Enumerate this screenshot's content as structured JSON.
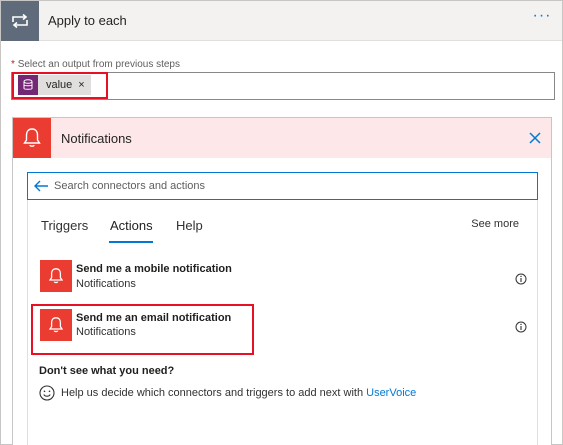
{
  "apply_each": {
    "title": "Apply to each",
    "menu_label": "···",
    "select_label": "Select an output from previous steps",
    "required_mark": "*",
    "token": {
      "label": "value",
      "remove": "×"
    }
  },
  "notifications": {
    "title": "Notifications",
    "search": {
      "placeholder": "Search connectors and actions"
    },
    "tabs": [
      {
        "label": "Triggers",
        "selected": false
      },
      {
        "label": "Actions",
        "selected": true
      },
      {
        "label": "Help",
        "selected": false
      }
    ],
    "see_more": "See more",
    "actions": [
      {
        "title": "Send me a mobile notification",
        "subtitle": "Notifications"
      },
      {
        "title": "Send me an email notification",
        "subtitle": "Notifications"
      }
    ],
    "dont_see": "Don't see what you need?",
    "help_text": "Help us decide which connectors and triggers to add next with",
    "help_link": "UserVoice"
  },
  "colors": {
    "accent": "#0078d4",
    "notification_red": "#ea3c31",
    "highlight_red": "#e81123",
    "token_purple": "#742774",
    "loop_gray": "#5f6b7a"
  },
  "icons": {
    "loop": "loop-arrows-icon",
    "database": "database-icon",
    "bell": "bell-icon",
    "close": "close-icon",
    "back": "arrow-left-icon",
    "info": "info-icon",
    "smile": "smiley-icon"
  }
}
